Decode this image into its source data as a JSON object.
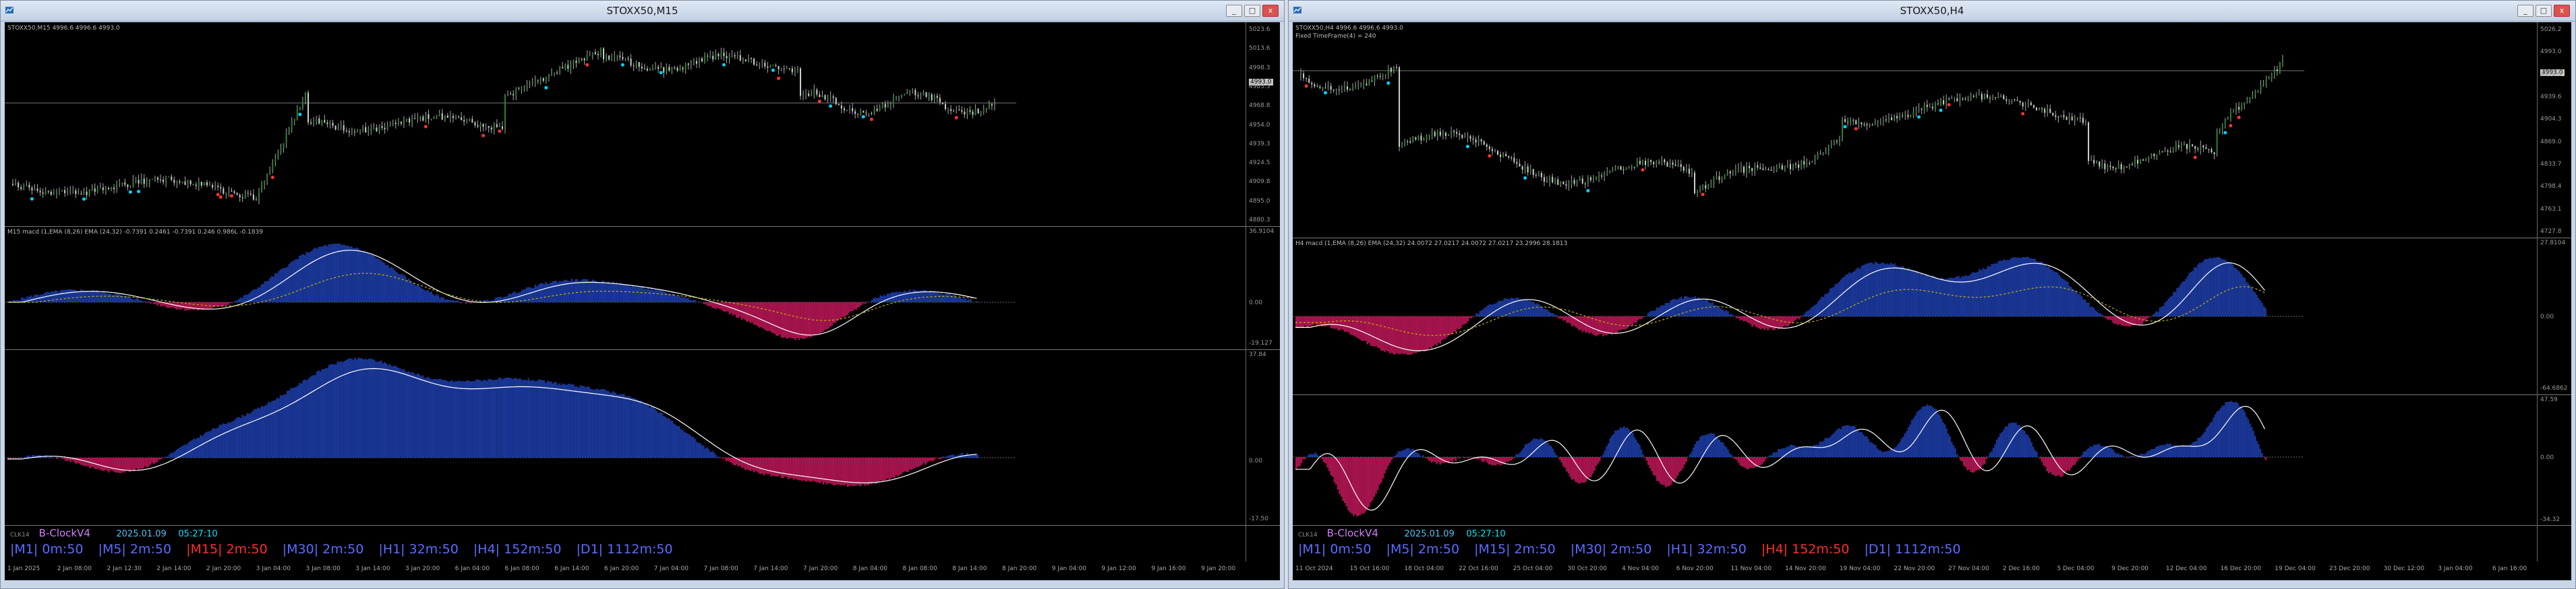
{
  "colors": {
    "background": "#000000",
    "bull_candle": "#2e7d32",
    "bear_candle": "#cccccc",
    "macd_pos": "#1e3fae",
    "macd_neg": "#c2185b",
    "signal_line": "#ffffff",
    "ema_line": "#c8b400",
    "tf_normal": "#5b6cff",
    "tf_active": "#ff2d2d",
    "brand": "#d67cff",
    "clock_time": "#00e5ff"
  },
  "left": {
    "title": "STOXX50,M15",
    "symbol_info": "STOXX50,M15  4996.6 4996.6 4993.0",
    "macd_label": "M15 macd (1,EMA (8,26) EMA (24,32)  -0.7391 0.2461 -0.7391 0.246 0.986L -0.1839",
    "macd_top": "36.9104",
    "macd_mid": "0.00",
    "macd_bottom": "-19.127",
    "osc_top": "37.84",
    "osc_mid": "0.00",
    "osc_bottom": "-17.50",
    "price_ticks": [
      "5023.6",
      "5013.6",
      "4998.3",
      "4983.5",
      "4968.8",
      "4954.0",
      "4939.3",
      "4924.5",
      "4909.8",
      "4895.0",
      "4880.3"
    ],
    "price_box": "4993.0",
    "time_ticks": [
      "1 Jan 2025",
      "2 Jan 08:00",
      "2 Jan 12:30",
      "2 Jan 14:00",
      "2 Jan 20:00",
      "3 Jan 04:00",
      "3 Jan 08:00",
      "3 Jan 14:00",
      "3 Jan 20:00",
      "6 Jan 04:00",
      "6 Jan 08:00",
      "6 Jan 14:00",
      "6 Jan 20:00",
      "7 Jan 04:00",
      "7 Jan 08:00",
      "7 Jan 14:00",
      "7 Jan 20:00",
      "8 Jan 04:00",
      "8 Jan 08:00",
      "8 Jan 14:00",
      "8 Jan 20:00",
      "9 Jan 04:00",
      "9 Jan 12:00",
      "9 Jan 16:00",
      "9 Jan 20:00"
    ]
  },
  "right": {
    "title": "STOXX50,H4",
    "symbol_info": "STOXX50,H4  4996.6 4996.6 4993.0",
    "sub_info": "Fixed TimeFrame(4) = 240",
    "macd_label": "H4 macd (1,EMA (8,26) EMA (24,32)  24.0072 27.0217 24.0072 27.0217 23.2996 28.1813",
    "macd_top": "27.8104",
    "macd_mid": "0.00",
    "macd_bottom": "-64.6862",
    "osc_top": "47.59",
    "osc_mid": "0.00",
    "osc_bottom": "-34.32",
    "price_ticks": [
      "5026.2",
      "4993.0",
      "4972.5",
      "4939.6",
      "4904.3",
      "4869.0",
      "4833.7",
      "4798.4",
      "4763.1",
      "4727.8"
    ],
    "price_box": "4993.0",
    "time_ticks": [
      "11 Oct 2024",
      "15 Oct 16:00",
      "18 Oct 04:00",
      "22 Oct 16:00",
      "25 Oct 04:00",
      "30 Oct 20:00",
      "4 Nov 04:00",
      "6 Nov 20:00",
      "11 Nov 04:00",
      "14 Nov 20:00",
      "19 Nov 04:00",
      "22 Nov 20:00",
      "27 Nov 04:00",
      "2 Dec 16:00",
      "5 Dec 04:00",
      "9 Dec 20:00",
      "12 Dec 04:00",
      "16 Dec 20:00",
      "19 Dec 04:00",
      "23 Dec 20:00",
      "30 Dec 12:00",
      "3 Jan 04:00",
      "6 Jan 16:00"
    ]
  },
  "clock": {
    "indicator_name": "CLK14",
    "brand": "B-ClockV4",
    "date": "2025.01.09",
    "time": "05:27:10",
    "timeframes": [
      {
        "label": "|M1| 0m:50"
      },
      {
        "label": "|M5| 2m:50"
      },
      {
        "label": "|M15| 2m:50"
      },
      {
        "label": "|M30| 2m:50"
      },
      {
        "label": "|H1| 32m:50"
      },
      {
        "label": "|H4| 152m:50"
      },
      {
        "label": "|D1| 1112m:50"
      }
    ],
    "left_active": "|M15| 2m:50",
    "right_active": "|H4| 152m:50"
  },
  "window_buttons": {
    "min": "_",
    "max": "□",
    "close": "x"
  }
}
